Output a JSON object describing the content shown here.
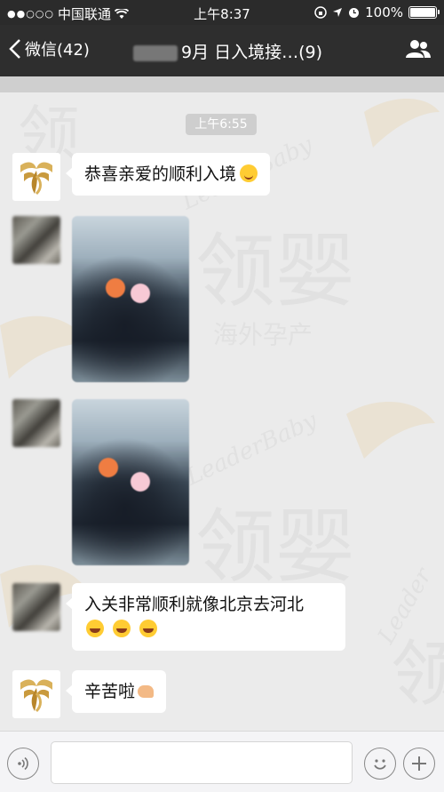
{
  "status_bar": {
    "carrier": "中国联通",
    "time": "上午8:37",
    "battery": "100%"
  },
  "nav": {
    "back_label": "微信(42)",
    "title": "9月 日入境接…(9)"
  },
  "chat": {
    "timestamp": "上午6:55",
    "messages": [
      {
        "type": "text",
        "sender": "logo",
        "text": "恭喜亲爱的顺利入境"
      },
      {
        "type": "image",
        "sender": "user"
      },
      {
        "type": "image",
        "sender": "user"
      },
      {
        "type": "text",
        "sender": "user",
        "text_line1": "入关非常顺利就像北京去河北"
      },
      {
        "type": "text",
        "sender": "logo",
        "text": "辛苦啦"
      }
    ]
  },
  "watermark": {
    "brand_cn": "领婴",
    "brand_en": "LeaderBaby",
    "tagline": "海外孕产"
  },
  "icons": [
    "back-chevron-icon",
    "wifi-icon",
    "location-icon",
    "alarm-icon",
    "group-members-icon",
    "voice-icon",
    "emoji-icon",
    "plus-icon"
  ],
  "colors": {
    "nav_bg": "#2e2e2e",
    "chat_bg": "#ebebeb",
    "bubble_bg": "#ffffff",
    "logo_gold": "#d9b15a"
  }
}
